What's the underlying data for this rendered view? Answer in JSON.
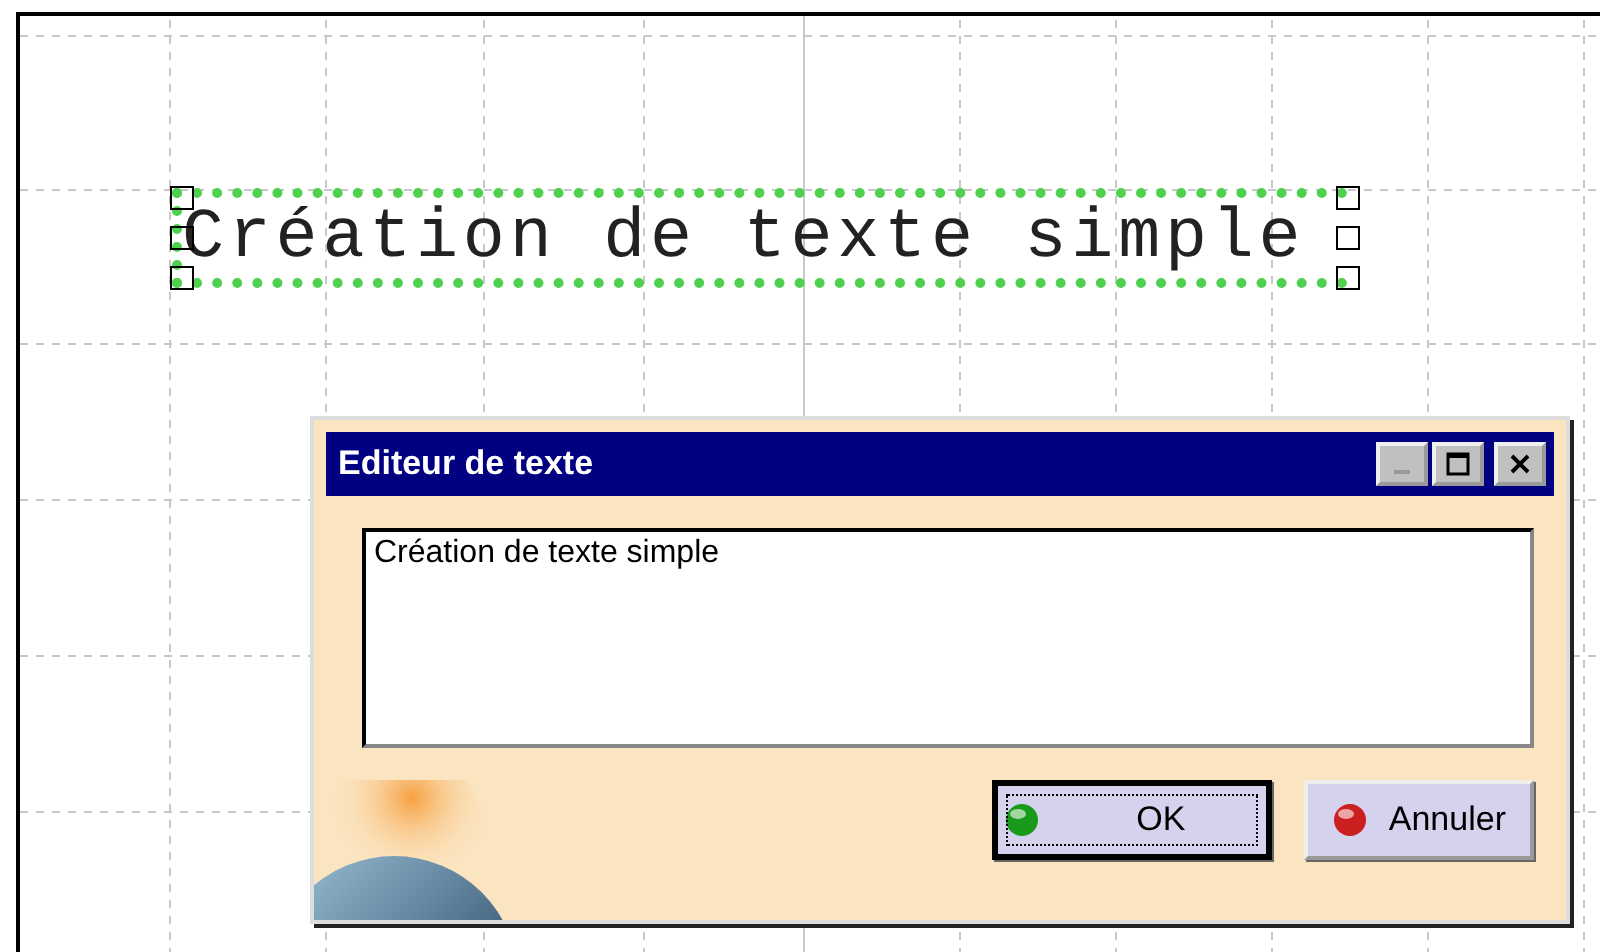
{
  "canvas": {
    "text_annotation": {
      "text": "Création de texte simple",
      "selected": true
    }
  },
  "dialog": {
    "title": "Editeur de texte",
    "title_buttons": [
      {
        "kind": "minimize",
        "disabled": true
      },
      {
        "kind": "maximize",
        "disabled": false
      },
      {
        "kind": "close",
        "disabled": false
      }
    ],
    "text_value": "Création de texte simple",
    "buttons": [
      {
        "label": "OK",
        "kind": "ok",
        "default": true
      },
      {
        "label": "Annuler",
        "kind": "cancel",
        "default": false
      }
    ]
  }
}
